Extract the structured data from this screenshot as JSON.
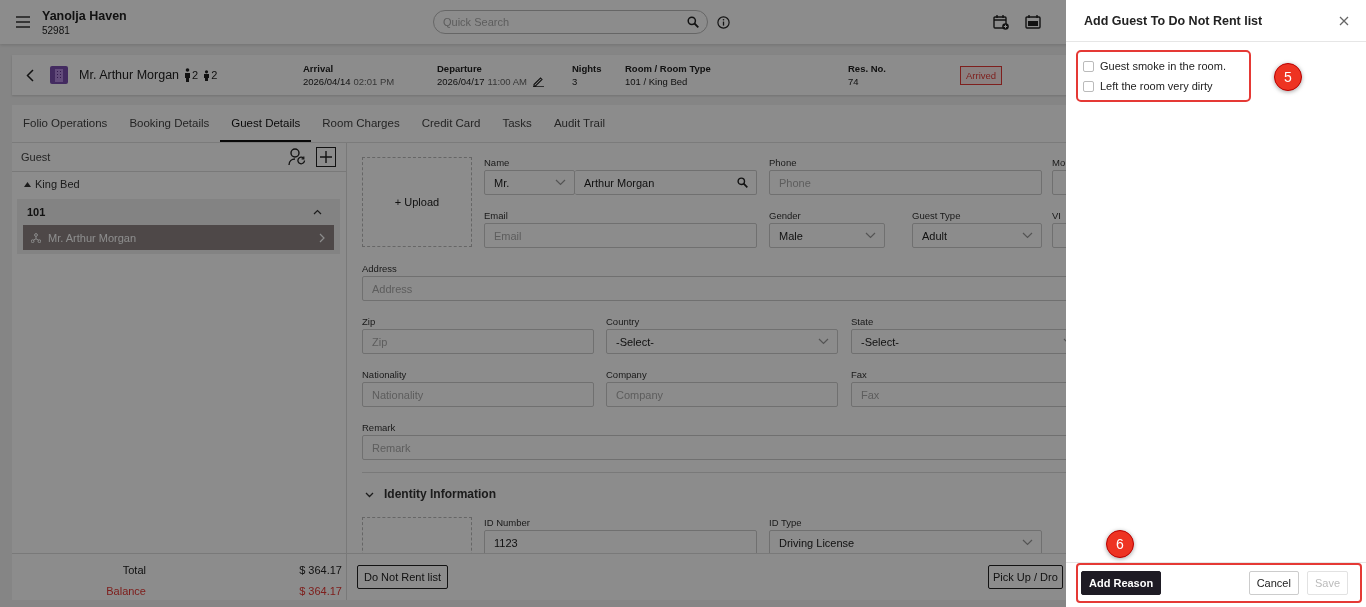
{
  "header": {
    "hotel_name": "Yanolja Haven",
    "hotel_code": "52981",
    "search": {
      "placeholder": "Quick Search"
    }
  },
  "reservation": {
    "guest_name": "Mr. Arthur Morgan",
    "adults": "2",
    "children": "2",
    "fields": [
      {
        "label": "Arrival",
        "value": "2026/04/14",
        "time": "02:01 PM",
        "editable": false
      },
      {
        "label": "Departure",
        "value": "2026/04/17",
        "time": "11:00 AM",
        "editable": true
      },
      {
        "label": "Nights",
        "value": "3",
        "editable": false
      },
      {
        "label": "Room / Room Type",
        "value": "101 / King Bed",
        "editable": false
      },
      {
        "label": "Res. No.",
        "value": "74",
        "editable": false
      }
    ],
    "status": "Arrived"
  },
  "tabs": [
    {
      "label": "Folio Operations",
      "selected": false
    },
    {
      "label": "Booking Details",
      "selected": false
    },
    {
      "label": "Guest Details",
      "selected": true
    },
    {
      "label": "Room Charges",
      "selected": false
    },
    {
      "label": "Credit Card",
      "selected": false
    },
    {
      "label": "Tasks",
      "selected": false
    },
    {
      "label": "Audit Trail",
      "selected": false
    }
  ],
  "guest_panel": {
    "title": "Guest",
    "room_types": [
      {
        "name": "King Bed",
        "expanded": true,
        "rooms": [
          {
            "number": "101",
            "expanded": true,
            "guests": [
              {
                "name": "Mr. Arthur Morgan",
                "selected": true
              }
            ]
          }
        ]
      }
    ]
  },
  "form": {
    "upload_label": "+ Upload",
    "rows": [
      [
        {
          "label": "Name",
          "kind": "name",
          "title": "Mr.",
          "value": "Arthur Morgan"
        },
        {
          "label": "Phone",
          "kind": "input",
          "placeholder": "Phone"
        },
        "",
        {
          "label": "Mo",
          "kind": "input"
        }
      ],
      [
        {
          "label": "Email",
          "kind": "input",
          "placeholder": "Email"
        },
        {
          "label": "Gender",
          "kind": "select",
          "value": "Male"
        },
        {
          "label": "Guest Type",
          "kind": "select",
          "value": "Adult"
        },
        {
          "label": "VI",
          "kind": "input"
        }
      ],
      [
        {
          "label": "Address",
          "kind": "input",
          "placeholder": "Address"
        }
      ],
      [
        {
          "label": "Zip",
          "kind": "input",
          "placeholder": "Zip"
        },
        {
          "label": "Country",
          "kind": "select",
          "value": "-Select-"
        },
        {
          "label": "State",
          "kind": "select",
          "value": "-Select-"
        }
      ],
      [
        {
          "label": "Nationality",
          "kind": "input",
          "placeholder": "Nationality"
        },
        {
          "label": "Company",
          "kind": "input",
          "placeholder": "Company"
        },
        {
          "label": "Fax",
          "kind": "input",
          "placeholder": "Fax"
        }
      ],
      [
        {
          "label": "Remark",
          "kind": "input",
          "placeholder": "Remark"
        }
      ]
    ],
    "identity": {
      "title": "Identity Information",
      "expanded": true,
      "fields": [
        {
          "label": "ID Number",
          "kind": "input",
          "value": "1123"
        },
        {
          "label": "ID Type",
          "kind": "select",
          "value": "Driving License"
        }
      ]
    }
  },
  "footer": {
    "totals": [
      {
        "label": "Total",
        "amount": "$ 364.17",
        "kind": "total"
      },
      {
        "label": "Balance",
        "amount": "$ 364.17",
        "kind": "balance"
      }
    ],
    "buttons": [
      "Do Not Rent list",
      "Pick Up / Dro"
    ]
  },
  "drawer": {
    "title": "Add Guest To Do Not Rent list",
    "callout": "5",
    "reasons": [
      {
        "label": "Guest smoke in the room.",
        "checked": false
      },
      {
        "label": "Left the room very dirty",
        "checked": false
      }
    ],
    "footer_callout": "6",
    "buttons": [
      {
        "label": "Add Reason",
        "kind": "primary",
        "disabled": false
      },
      {
        "label": "Cancel",
        "kind": "secondary",
        "disabled": false
      },
      {
        "label": "Save",
        "kind": "secondary",
        "disabled": true
      }
    ]
  }
}
